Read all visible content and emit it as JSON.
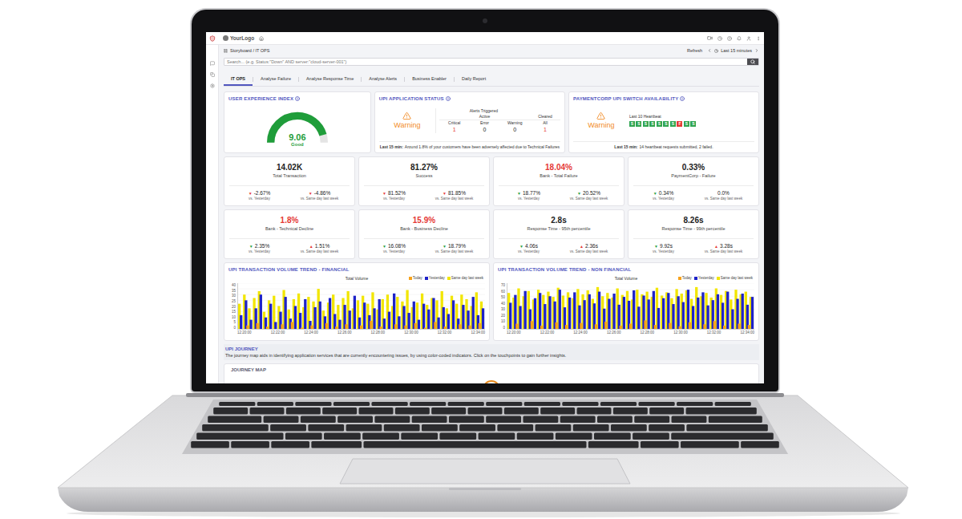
{
  "header": {
    "logo": "YourLogo"
  },
  "breadcrumb": {
    "path": "Storyboard / IT OPS",
    "refresh": "Refresh",
    "time_range": "Last 15 minutes"
  },
  "search": {
    "placeholder": "Search... (e.g. Status:\"Down\" AND server:\"cloud-server-001\")"
  },
  "tabs": [
    {
      "label": "IT OPS",
      "selected": true
    },
    {
      "label": "Analyse Failure",
      "selected": false
    },
    {
      "label": "Analyse Response Time",
      "selected": false
    },
    {
      "label": "Analyse Alerts",
      "selected": false
    },
    {
      "label": "Business Enabler",
      "selected": false
    },
    {
      "label": "Daily Report",
      "selected": false
    }
  ],
  "ux_index": {
    "title": "USER EXPERIENCE INDEX",
    "value": "9.06",
    "rating": "Good",
    "level": 0.906
  },
  "app_status": {
    "title": "UPI APPLICATION STATUS",
    "status": "Warning",
    "alerts_title": "Alerts Triggered",
    "groups": [
      {
        "label": "Active",
        "columns": [
          {
            "label": "Critical",
            "value": "1",
            "highlight": true
          },
          {
            "label": "Error",
            "value": "0",
            "highlight": false
          },
          {
            "label": "Warning",
            "value": "0",
            "highlight": false
          }
        ]
      },
      {
        "label": "Cleared",
        "columns": [
          {
            "label": "All",
            "value": "1",
            "highlight": true
          }
        ]
      }
    ],
    "note_prefix": "Last 15 min:",
    "note": "Around 1.8% of your customers have been adversely affected due to Technical Failures"
  },
  "switch": {
    "title": "PAYMENTCORP UPI SWITCH AVAILABILITY",
    "status": "Warning",
    "heartbeat_title": "Last 10 Heartbeat",
    "heartbeats": [
      {
        "label": "S",
        "ok": true
      },
      {
        "label": "S",
        "ok": true
      },
      {
        "label": "S",
        "ok": true
      },
      {
        "label": "S",
        "ok": true
      },
      {
        "label": "S",
        "ok": true
      },
      {
        "label": "S",
        "ok": true
      },
      {
        "label": "S",
        "ok": true
      },
      {
        "label": "F",
        "ok": false
      },
      {
        "label": "S",
        "ok": true
      },
      {
        "label": "S",
        "ok": true
      }
    ],
    "note_prefix": "Last 15 min:",
    "note": "14 heartbeat requests submitted, 2 failed."
  },
  "kpis": [
    {
      "value": "14.02K",
      "label": "Total Transaction",
      "alert": false,
      "deltas": [
        {
          "arrow": "▼",
          "value": "-2.67%",
          "caption": "vs. Yesterday",
          "good": false
        },
        {
          "arrow": "▼",
          "value": "-4.86%",
          "caption": "vs. Same day last week",
          "good": false
        }
      ]
    },
    {
      "value": "81.27%",
      "label": "Success",
      "alert": false,
      "deltas": [
        {
          "arrow": "▼",
          "value": "81.52%",
          "caption": "vs. Yesterday",
          "good": false
        },
        {
          "arrow": "▼",
          "value": "81.85%",
          "caption": "vs. Same day last week",
          "good": false
        }
      ]
    },
    {
      "value": "18.04%",
      "label": "Bank - Total Failure",
      "alert": true,
      "deltas": [
        {
          "arrow": "▼",
          "value": "18.77%",
          "caption": "vs. Yesterday",
          "good": true
        },
        {
          "arrow": "▼",
          "value": "20.52%",
          "caption": "vs. Same day last week",
          "good": true
        }
      ]
    },
    {
      "value": "0.33%",
      "label": "PaymentCorp - Failure",
      "alert": false,
      "deltas": [
        {
          "arrow": "▼",
          "value": "0.34%",
          "caption": "vs. Yesterday",
          "good": true
        },
        {
          "arrow": "",
          "value": "0.0%",
          "caption": "vs. Same day last week"
        }
      ]
    },
    {
      "value": "1.8%",
      "label": "Bank - Technical Decline",
      "alert": true,
      "deltas": [
        {
          "arrow": "▼",
          "value": "2.35%",
          "caption": "vs. Yesterday",
          "good": true
        },
        {
          "arrow": "▲",
          "value": "1.51%",
          "caption": "vs. Same day last week",
          "good": false
        }
      ]
    },
    {
      "value": "15.9%",
      "label": "Bank - Business Decline",
      "alert": true,
      "deltas": [
        {
          "arrow": "▼",
          "value": "16.08%",
          "caption": "vs. Yesterday",
          "good": true
        },
        {
          "arrow": "▼",
          "value": "18.79%",
          "caption": "vs. Same day last week",
          "good": true
        }
      ]
    },
    {
      "value": "2.8s",
      "label": "Response Time - 95th percentile",
      "alert": false,
      "deltas": [
        {
          "arrow": "▼",
          "value": "4.06s",
          "caption": "vs. Yesterday",
          "good": true
        },
        {
          "arrow": "▲",
          "value": "2.36s",
          "caption": "vs. Same day last week",
          "good": false
        }
      ]
    },
    {
      "value": "8.26s",
      "label": "Response Time - 99th percentile",
      "alert": false,
      "deltas": [
        {
          "arrow": "▼",
          "value": "9.92s",
          "caption": "vs. Yesterday",
          "good": true
        },
        {
          "arrow": "▲",
          "value": "3.28s",
          "caption": "vs. Same day last week",
          "good": false
        }
      ]
    }
  ],
  "charts": [
    {
      "title": "UPI TRANSACTION VOLUME TREND - FINANCIAL",
      "chart_title": "Total Volume",
      "y_max": 40,
      "y_ticks": [
        "40",
        "35",
        "30",
        "25",
        "20",
        "15",
        "10",
        "5",
        "0"
      ],
      "x_ticks": [
        "12:20:00",
        "12:22:00",
        "12:24:00",
        "12:26:00",
        "12:28:00",
        "12:30:00",
        "12:32:00",
        "12:34:00"
      ],
      "series": [
        {
          "name": "Today",
          "color": "#f7a21b",
          "values": [
            0,
            3,
            0,
            5,
            0,
            2,
            0,
            0,
            4,
            0,
            6,
            0,
            1,
            0,
            3,
            0,
            0,
            5,
            0,
            2,
            0,
            4,
            0,
            0,
            3,
            0,
            7,
            0,
            2,
            0,
            0,
            4,
            0,
            3,
            0,
            5,
            0,
            1,
            0,
            6,
            0,
            2,
            0,
            0,
            4,
            0,
            3,
            0,
            5,
            0
          ]
        },
        {
          "name": "Yesterday",
          "color": "#1e22c8",
          "values": [
            12,
            25,
            8,
            18,
            30,
            10,
            22,
            6,
            15,
            28,
            9,
            20,
            14,
            26,
            7,
            19,
            24,
            11,
            27,
            13,
            8,
            21,
            16,
            29,
            10,
            23,
            12,
            18,
            26,
            9,
            15,
            31,
            11,
            20,
            14,
            24,
            8,
            22,
            17,
            27,
            10,
            19,
            13,
            25,
            9,
            21,
            16,
            28,
            12,
            18
          ]
        },
        {
          "name": "Same day last week",
          "color": "#f2e600",
          "values": [
            22,
            30,
            18,
            27,
            33,
            15,
            25,
            29,
            20,
            34,
            17,
            26,
            31,
            19,
            28,
            24,
            35,
            16,
            23,
            30,
            21,
            27,
            33,
            18,
            25,
            29,
            22,
            32,
            17,
            26,
            30,
            20,
            28,
            24,
            34,
            19,
            23,
            31,
            21,
            27,
            25,
            33,
            18,
            29,
            22,
            30,
            26,
            20,
            32,
            24
          ]
        }
      ]
    },
    {
      "title": "UPI TRANSACTION VOLUME TREND - NON FINANCIAL",
      "chart_title": "Total Volume",
      "y_max": 70,
      "y_ticks": [
        "70",
        "60",
        "50",
        "40",
        "30",
        "20",
        "10",
        "0"
      ],
      "x_ticks": [
        "12:20:00",
        "12:22:00",
        "12:24:00",
        "12:26:00",
        "12:28:00",
        "12:30:00",
        "12:32:00",
        "12:34:00"
      ],
      "series": [
        {
          "name": "Today",
          "color": "#f7a21b",
          "values": [
            0,
            8,
            0,
            0,
            12,
            0,
            5,
            0,
            0,
            10,
            0,
            6,
            0,
            0,
            9,
            0,
            0,
            7,
            0,
            11,
            0,
            0,
            5,
            0,
            8,
            0,
            0,
            13,
            0,
            6,
            0,
            0,
            9,
            0,
            4,
            0,
            10,
            0,
            0,
            7,
            0,
            12,
            0,
            5,
            0,
            0,
            8,
            0,
            6,
            0
          ]
        },
        {
          "name": "Yesterday",
          "color": "#1e22c8",
          "values": [
            40,
            52,
            35,
            58,
            30,
            47,
            55,
            38,
            50,
            42,
            60,
            33,
            48,
            56,
            36,
            44,
            53,
            39,
            57,
            31,
            46,
            54,
            37,
            49,
            43,
            59,
            34,
            51,
            45,
            58,
            32,
            47,
            55,
            38,
            50,
            41,
            60,
            35,
            48,
            56,
            36,
            44,
            53,
            40,
            57,
            30,
            46,
            54,
            37,
            49
          ]
        },
        {
          "name": "Same day last week",
          "color": "#f2e600",
          "values": [
            55,
            48,
            62,
            50,
            58,
            45,
            60,
            52,
            57,
            49,
            63,
            51,
            56,
            47,
            61,
            53,
            59,
            46,
            64,
            50,
            55,
            48,
            62,
            52,
            58,
            45,
            60,
            53,
            57,
            49,
            63,
            51,
            56,
            47,
            61,
            54,
            59,
            46,
            64,
            50,
            55,
            48,
            62,
            52,
            58,
            45,
            60,
            53,
            57,
            49
          ]
        }
      ]
    }
  ],
  "journey": {
    "title": "UPI JOURNEY",
    "description": "The journey map aids in identifying application services that are currently encountering issues, by using color-coded indicators. Click on the touchpoints to gain further insights.",
    "map_title": "JOURNEY MAP"
  }
}
